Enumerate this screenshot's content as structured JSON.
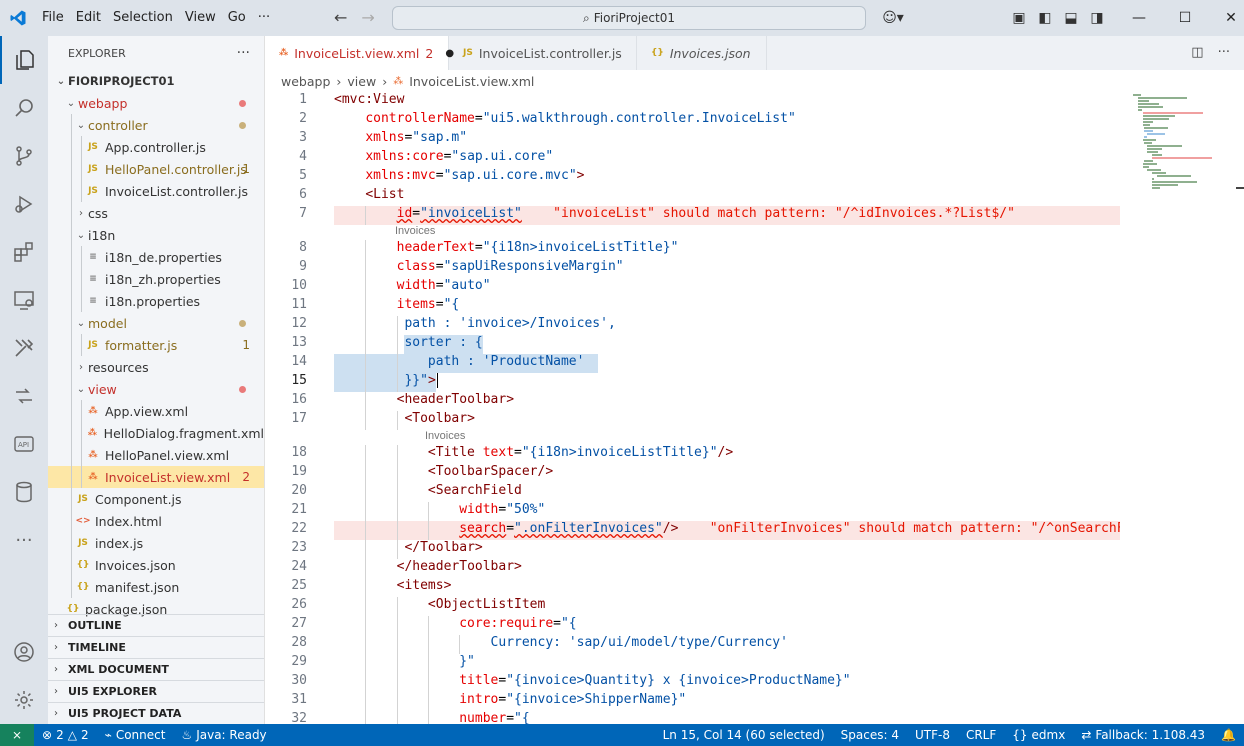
{
  "menu": [
    "File",
    "Edit",
    "Selection",
    "View",
    "Go",
    "···"
  ],
  "search_text": "FioriProject01",
  "explorer": {
    "title": "EXPLORER",
    "root": "FIORIPROJECT01",
    "items": [
      {
        "label": "webapp",
        "kind": "folder",
        "open": true,
        "depth": 1,
        "color": "#c4302b",
        "mark": "dot",
        "markColor": "#e97a7a"
      },
      {
        "label": "controller",
        "kind": "folder",
        "open": true,
        "depth": 2,
        "color": "#8a6d1f",
        "mark": "dot",
        "markColor": "#c9b07a"
      },
      {
        "label": "App.controller.js",
        "kind": "js",
        "depth": 3,
        "color": "#333"
      },
      {
        "label": "HelloPanel.controller.js",
        "kind": "js",
        "depth": 3,
        "color": "#8a6d1f",
        "mark": "1",
        "markColor": "#8a6d1f"
      },
      {
        "label": "InvoiceList.controller.js",
        "kind": "js",
        "depth": 3,
        "color": "#333"
      },
      {
        "label": "css",
        "kind": "folder",
        "open": false,
        "depth": 2,
        "color": "#333"
      },
      {
        "label": "i18n",
        "kind": "folder",
        "open": true,
        "depth": 2,
        "color": "#333"
      },
      {
        "label": "i18n_de.properties",
        "kind": "props",
        "depth": 3,
        "color": "#333"
      },
      {
        "label": "i18n_zh.properties",
        "kind": "props",
        "depth": 3,
        "color": "#333"
      },
      {
        "label": "i18n.properties",
        "kind": "props",
        "depth": 3,
        "color": "#333"
      },
      {
        "label": "model",
        "kind": "folder",
        "open": true,
        "depth": 2,
        "color": "#8a6d1f",
        "mark": "dot",
        "markColor": "#c9b07a"
      },
      {
        "label": "formatter.js",
        "kind": "js",
        "depth": 3,
        "color": "#8a6d1f",
        "mark": "1",
        "markColor": "#8a6d1f"
      },
      {
        "label": "resources",
        "kind": "folder",
        "open": false,
        "depth": 2,
        "color": "#333"
      },
      {
        "label": "view",
        "kind": "folder",
        "open": true,
        "depth": 2,
        "color": "#c4302b",
        "mark": "dot",
        "markColor": "#e97a7a"
      },
      {
        "label": "App.view.xml",
        "kind": "xml",
        "depth": 3,
        "color": "#333"
      },
      {
        "label": "HelloDialog.fragment.xml",
        "kind": "xml",
        "depth": 3,
        "color": "#333"
      },
      {
        "label": "HelloPanel.view.xml",
        "kind": "xml",
        "depth": 3,
        "color": "#333"
      },
      {
        "label": "InvoiceList.view.xml",
        "kind": "xml",
        "depth": 3,
        "color": "#c4302b",
        "mark": "2",
        "markColor": "#c4302b",
        "selected": true
      },
      {
        "label": "Component.js",
        "kind": "js",
        "depth": 2,
        "color": "#333"
      },
      {
        "label": "Index.html",
        "kind": "html",
        "depth": 2,
        "color": "#333"
      },
      {
        "label": "index.js",
        "kind": "js",
        "depth": 2,
        "color": "#333"
      },
      {
        "label": "Invoices.json",
        "kind": "json",
        "depth": 2,
        "color": "#333"
      },
      {
        "label": "manifest.json",
        "kind": "json",
        "depth": 2,
        "color": "#333"
      },
      {
        "label": "package.json",
        "kind": "json",
        "depth": 1,
        "color": "#333"
      }
    ]
  },
  "panels": [
    "OUTLINE",
    "TIMELINE",
    "XML DOCUMENT",
    "UI5 EXPLORER",
    "UI5 PROJECT DATA"
  ],
  "tabs": [
    {
      "label": "InvoiceList.view.xml",
      "badge": "2",
      "icon": "rss-icon",
      "active": true
    },
    {
      "label": "InvoiceList.controller.js",
      "icon": "js-icon",
      "active": false
    },
    {
      "label": "Invoices.json",
      "icon": "braces-icon",
      "active": false,
      "italic": true
    }
  ],
  "breadcrumb": [
    "webapp",
    "view",
    "InvoiceList.view.xml"
  ],
  "code": [
    {
      "n": "1",
      "parts": [
        [
          "t",
          "<mvc:View"
        ]
      ],
      "indent": 0
    },
    {
      "n": "2",
      "parts": [
        [
          "a",
          "controllerName"
        ],
        [
          "p",
          "="
        ],
        [
          "s",
          "\"ui5.walkthrough.controller.InvoiceList\""
        ]
      ],
      "indent": 4
    },
    {
      "n": "3",
      "parts": [
        [
          "a",
          "xmlns"
        ],
        [
          "p",
          "="
        ],
        [
          "s",
          "\"sap.m\""
        ]
      ],
      "indent": 4
    },
    {
      "n": "4",
      "parts": [
        [
          "a",
          "xmlns:core"
        ],
        [
          "p",
          "="
        ],
        [
          "s",
          "\"sap.ui.core\""
        ]
      ],
      "indent": 4
    },
    {
      "n": "5",
      "parts": [
        [
          "a",
          "xmlns:mvc"
        ],
        [
          "p",
          "="
        ],
        [
          "s",
          "\"sap.ui.core.mvc\""
        ],
        [
          "t",
          ">"
        ]
      ],
      "indent": 4
    },
    {
      "n": "6",
      "parts": [
        [
          "t",
          "<List"
        ]
      ],
      "indent": 4
    },
    {
      "n": "7",
      "parts": [
        [
          "a sq",
          "id"
        ],
        [
          "p",
          "="
        ],
        [
          "s sq",
          "\"invoiceList\""
        ],
        [
          "e",
          "    \"invoiceList\" should match pattern: \"/^idInvoices.*?List$/\""
        ]
      ],
      "indent": 8,
      "error": true,
      "hint": "Invoices"
    },
    {
      "n": "8",
      "parts": [
        [
          "a",
          "headerText"
        ],
        [
          "p",
          "="
        ],
        [
          "s",
          "\"{i18n>invoiceListTitle}\""
        ]
      ],
      "indent": 8
    },
    {
      "n": "9",
      "parts": [
        [
          "a",
          "class"
        ],
        [
          "p",
          "="
        ],
        [
          "s",
          "\"sapUiResponsiveMargin\""
        ]
      ],
      "indent": 8
    },
    {
      "n": "10",
      "parts": [
        [
          "a",
          "width"
        ],
        [
          "p",
          "="
        ],
        [
          "s",
          "\"auto\""
        ]
      ],
      "indent": 8
    },
    {
      "n": "11",
      "parts": [
        [
          "a",
          "items"
        ],
        [
          "p",
          "="
        ],
        [
          "s",
          "\"{"
        ]
      ],
      "indent": 8
    },
    {
      "n": "12",
      "parts": [
        [
          "s",
          "path : 'invoice>/Invoices',"
        ]
      ],
      "indent": 9
    },
    {
      "n": "13",
      "parts": [
        [
          "s",
          "sorter : {"
        ]
      ],
      "indent": 9,
      "sel": "partial"
    },
    {
      "n": "14",
      "parts": [
        [
          "s",
          "path : 'ProductName'"
        ]
      ],
      "indent": 12,
      "sel": "full"
    },
    {
      "n": "15",
      "parts": [
        [
          "s",
          "}}\""
        ],
        [
          "t",
          ">"
        ]
      ],
      "indent": 9,
      "sel": "head",
      "cursor": true
    },
    {
      "n": "16",
      "parts": [
        [
          "t",
          "<headerToolbar>"
        ]
      ],
      "indent": 8
    },
    {
      "n": "17",
      "parts": [
        [
          "t",
          "<Toolbar>"
        ]
      ],
      "indent": 9,
      "hint": "Invoices"
    },
    {
      "n": "18",
      "parts": [
        [
          "t",
          "<Title "
        ],
        [
          "a",
          "text"
        ],
        [
          "p",
          "="
        ],
        [
          "s",
          "\"{i18n>invoiceListTitle}\""
        ],
        [
          "t",
          "/>"
        ]
      ],
      "indent": 12
    },
    {
      "n": "19",
      "parts": [
        [
          "t",
          "<ToolbarSpacer/>"
        ]
      ],
      "indent": 12
    },
    {
      "n": "20",
      "parts": [
        [
          "t",
          "<SearchField"
        ]
      ],
      "indent": 12
    },
    {
      "n": "21",
      "parts": [
        [
          "a",
          "width"
        ],
        [
          "p",
          "="
        ],
        [
          "s",
          "\"50%\""
        ]
      ],
      "indent": 16
    },
    {
      "n": "22",
      "parts": [
        [
          "a sq",
          "search"
        ],
        [
          "p",
          "="
        ],
        [
          "s sq",
          "\".onFilterInvoices\""
        ],
        [
          "t",
          "/>"
        ],
        [
          "e",
          "    \"onFilterInvoices\" should match pattern: \"/^onSearchFie"
        ]
      ],
      "indent": 16,
      "error": true
    },
    {
      "n": "23",
      "parts": [
        [
          "t",
          "</Toolbar>"
        ]
      ],
      "indent": 9
    },
    {
      "n": "24",
      "parts": [
        [
          "t",
          "</headerToolbar>"
        ]
      ],
      "indent": 8
    },
    {
      "n": "25",
      "parts": [
        [
          "t",
          "<items>"
        ]
      ],
      "indent": 8
    },
    {
      "n": "26",
      "parts": [
        [
          "t",
          "<ObjectListItem"
        ]
      ],
      "indent": 12
    },
    {
      "n": "27",
      "parts": [
        [
          "a",
          "core:require"
        ],
        [
          "p",
          "="
        ],
        [
          "s",
          "\"{"
        ]
      ],
      "indent": 16
    },
    {
      "n": "28",
      "parts": [
        [
          "s",
          "Currency: 'sap/ui/model/type/Currency'"
        ]
      ],
      "indent": 20
    },
    {
      "n": "29",
      "parts": [
        [
          "s",
          "}\""
        ]
      ],
      "indent": 16
    },
    {
      "n": "30",
      "parts": [
        [
          "a",
          "title"
        ],
        [
          "p",
          "="
        ],
        [
          "s",
          "\"{invoice>Quantity} x {invoice>ProductName}\""
        ]
      ],
      "indent": 16
    },
    {
      "n": "31",
      "parts": [
        [
          "a",
          "intro"
        ],
        [
          "p",
          "="
        ],
        [
          "s",
          "\"{invoice>ShipperName}\""
        ]
      ],
      "indent": 16
    },
    {
      "n": "32",
      "parts": [
        [
          "a",
          "number"
        ],
        [
          "p",
          "="
        ],
        [
          "s",
          "\"{"
        ]
      ],
      "indent": 16
    }
  ],
  "status": {
    "errors": "2",
    "warnings": "2",
    "connect": "Connect",
    "java": "Java: Ready",
    "position": "Ln 15, Col 14 (60 selected)",
    "spaces": "Spaces: 4",
    "encoding": "UTF-8",
    "eol": "CRLF",
    "lang": "edmx",
    "fallback": "Fallback: 1.108.43"
  },
  "colors": {
    "accent": "#0066b8",
    "remote": "#16825d",
    "error": "#e51400",
    "tag": "#800000",
    "attr": "#e50000",
    "string": "#0451a5"
  }
}
